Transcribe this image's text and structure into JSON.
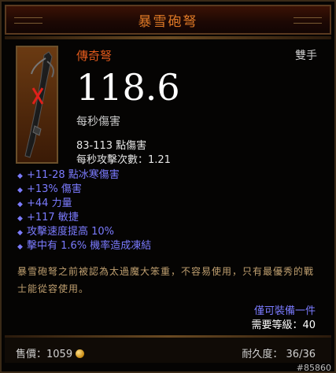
{
  "item": {
    "name": "暴雪砲弩",
    "rarity": "傳奇弩",
    "slot": "雙手",
    "dps": "118.6",
    "dps_label": "每秒傷害",
    "damage": "83-113 點傷害",
    "attacks_per_second": "每秒攻擊次數：1.21",
    "affixes": [
      "+11-28 點冰寒傷害",
      "+13% 傷害",
      "+44 力量",
      "+117 敏捷",
      "攻擊速度提高 10%",
      "擊中有 1.6% 機率造成凍結"
    ],
    "flavor": "暴雪砲弩之前被認為太過魔大笨重，不容易使用，只有最優秀的戰士能從容使用。",
    "restriction": "僅可裝備一件",
    "required_level": "需要等級：40",
    "price_label": "售價：1059",
    "durability": "耐久度： 36/36",
    "id_tag": "#85860"
  },
  "icons": {
    "item_icon": "crossbow-icon",
    "unidentified_marker": "red-x-icon",
    "gold": "gold-coin-icon"
  },
  "colors": {
    "title": "#e07a26",
    "rarity": "#e25a1c",
    "affix": "#7b7bff",
    "flavor": "#c0a070"
  }
}
